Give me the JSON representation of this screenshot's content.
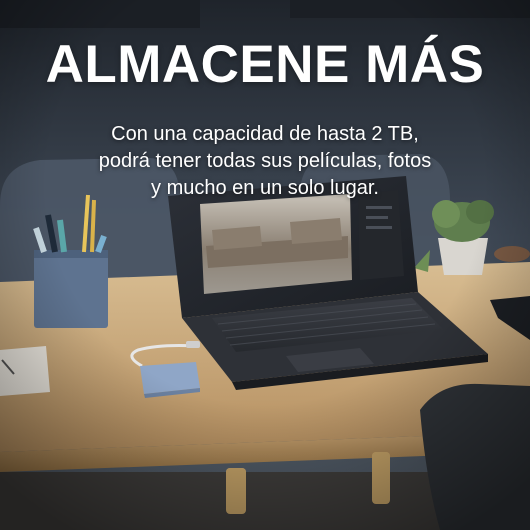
{
  "headline": "ALMACENE MÁS",
  "subtext_lines": [
    "Con una capacidad de hasta 2 TB,",
    "podrá tener todas sus películas, fotos",
    "y mucho en un solo lugar."
  ],
  "colors": {
    "text": "#ffffff",
    "background_wall": "#3a4452",
    "desk": "#c9a97c",
    "drive": "#8fa6c7"
  }
}
